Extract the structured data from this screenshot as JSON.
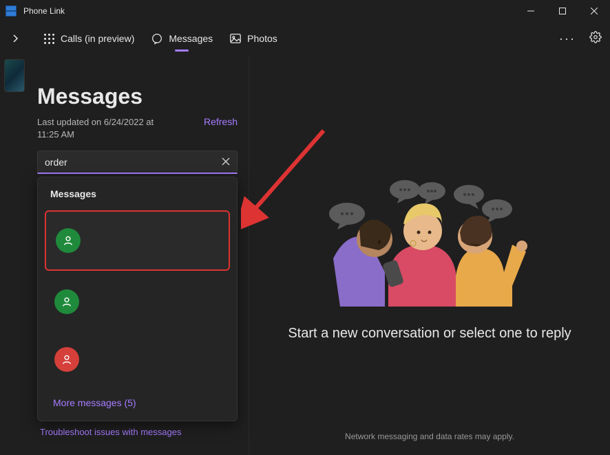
{
  "titlebar": {
    "app_name": "Phone Link"
  },
  "nav": {
    "calls": "Calls (in preview)",
    "messages": "Messages",
    "photos": "Photos"
  },
  "panel": {
    "title": "Messages",
    "last_updated": "Last updated on 6/24/2022 at 11:25 AM",
    "refresh": "Refresh",
    "search_value": "order",
    "dropdown_header": "Messages",
    "more_messages": "More messages (5)",
    "troubleshoot": "Troubleshoot issues with messages"
  },
  "right": {
    "headline": "Start a new conversation or select one to reply",
    "disclaimer": "Network messaging and data rates may apply."
  },
  "colors": {
    "accent": "#a67cff",
    "avatar_green": "#1f8a3b",
    "avatar_red": "#d5403a"
  }
}
